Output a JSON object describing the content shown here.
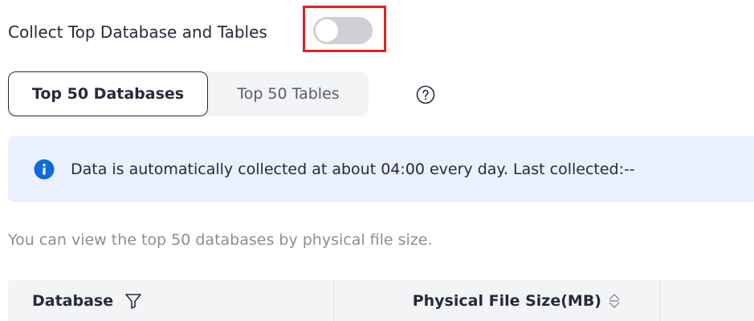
{
  "collect_toggle": {
    "label": "Collect Top Database and Tables",
    "enabled": false
  },
  "tabs": [
    {
      "label": "Top 50 Databases",
      "active": true
    },
    {
      "label": "Top 50 Tables",
      "active": false
    }
  ],
  "help_icon": "question-circle-icon",
  "info_banner": {
    "icon": "info-circle-icon",
    "text": "Data is automatically collected at about 04:00 every day. Last collected:--"
  },
  "description": "You can view the top 50 databases by physical file size.",
  "table": {
    "columns": [
      {
        "label": "Database",
        "icon": "filter-icon"
      },
      {
        "label": "Physical File Size(MB)",
        "icon": "sort-icon"
      }
    ]
  },
  "colors": {
    "highlight_border": "#e02020",
    "banner_background": "#eaf0fd",
    "info_icon": "#0d6bdb",
    "toggle_off": "#cfd0d3",
    "primary_text": "#252b3a",
    "secondary_text": "#8a8e99"
  }
}
